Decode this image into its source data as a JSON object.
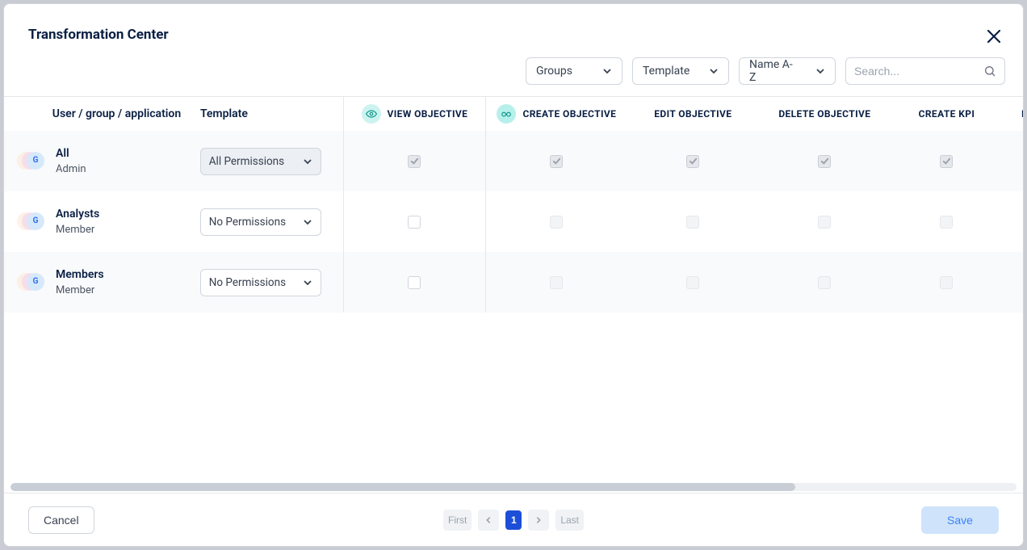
{
  "title": "Transformation Center",
  "filters": {
    "groups": "Groups",
    "template": "Template",
    "sort": "Name A-Z",
    "search_placeholder": "Search..."
  },
  "columns": {
    "user": "User / group / application",
    "template": "Template",
    "perms": [
      "VIEW OBJECTIVE",
      "CREATE OBJECTIVE",
      "EDIT OBJECTIVE",
      "DELETE OBJECTIVE",
      "CREATE KPI",
      "EXPORT OBJECTIVE"
    ]
  },
  "rows": [
    {
      "avatar": "G",
      "name": "All",
      "role": "Admin",
      "template": "All Permissions",
      "template_active": true,
      "checks": [
        "checked",
        "checked",
        "checked",
        "checked",
        "checked",
        "checked"
      ]
    },
    {
      "avatar": "G",
      "name": "Analysts",
      "role": "Member",
      "template": "No Permissions",
      "template_active": false,
      "checks": [
        "empty",
        "off",
        "off",
        "off",
        "off",
        "off"
      ]
    },
    {
      "avatar": "G",
      "name": "Members",
      "role": "Member",
      "template": "No Permissions",
      "template_active": false,
      "checks": [
        "empty",
        "off",
        "off",
        "off",
        "off",
        "off"
      ]
    }
  ],
  "pagination": {
    "first": "First",
    "last": "Last",
    "current": "1"
  },
  "footer": {
    "cancel": "Cancel",
    "save": "Save"
  }
}
